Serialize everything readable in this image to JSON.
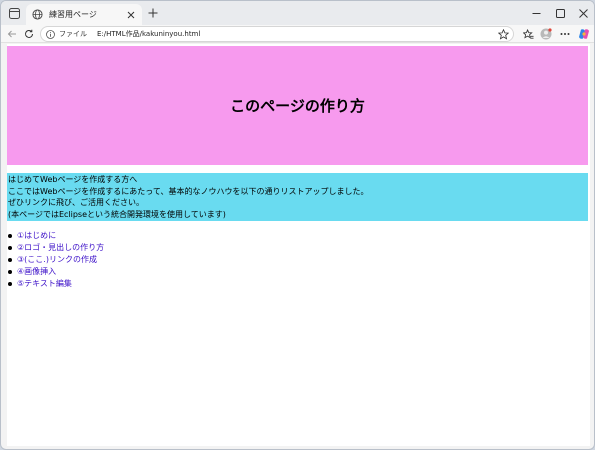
{
  "browser": {
    "tab_title": "練習用ページ",
    "address_label": "ファイル",
    "url": "E:/HTML作品/kakuninyou.html"
  },
  "page": {
    "heading": "このページの作り方",
    "intro_lines": [
      "はじめてWebページを作成する方へ",
      "ここではWebページを作成するにあたって、基本的なノウハウを以下の通りリストアップしました。",
      "ぜひリンクに飛び、ご活用ください。",
      "(本ページではEclipseという統合開発環境を使用しています)"
    ],
    "links": [
      "①はじめに",
      "②ロゴ・見出しの作り方",
      "③(ここ.)リンクの作成",
      "④画像挿入",
      "⑤テキスト編集"
    ]
  },
  "colors": {
    "hero_bg": "#f79aee",
    "intro_bg": "#69dbf0",
    "link": "#3b0fc8"
  }
}
